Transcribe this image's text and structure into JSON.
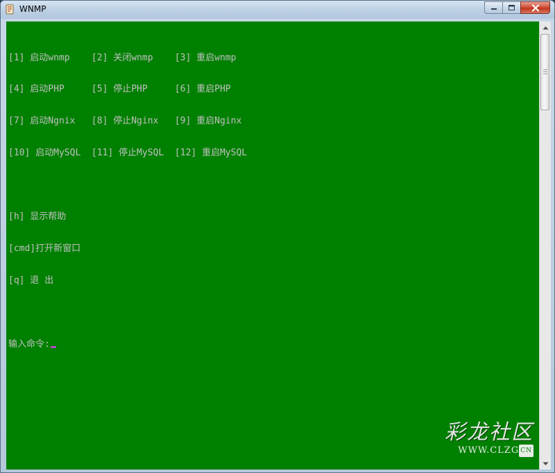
{
  "window": {
    "title": "WNMP",
    "icon": "wnmp-app-icon",
    "controls": {
      "minimize": "minimize-icon",
      "maximize": "maximize-icon",
      "close": "close-icon"
    }
  },
  "console": {
    "background": "#008000",
    "text_color": "#c0c0c0",
    "cursor_color": "#b04abf",
    "lines": [
      "[1] 启动wnmp    [2] 关闭wnmp    [3] 重启wnmp",
      "[4] 启动PHP     [5] 停止PHP     [6] 重启PHP",
      "[7] 启动Ngnix   [8] 停止Nginx   [9] 重启Nginx",
      "[10] 启动MySQL  [11] 停止MySQL  [12] 重启MySQL",
      "",
      "[h] 显示帮助",
      "[cmd]打开新窗口",
      "[q] 退 出",
      ""
    ],
    "prompt": "输入命令:"
  },
  "watermark": {
    "title": "彩龙社区",
    "url": "WWW.CLZG",
    "suffix": "CN"
  }
}
